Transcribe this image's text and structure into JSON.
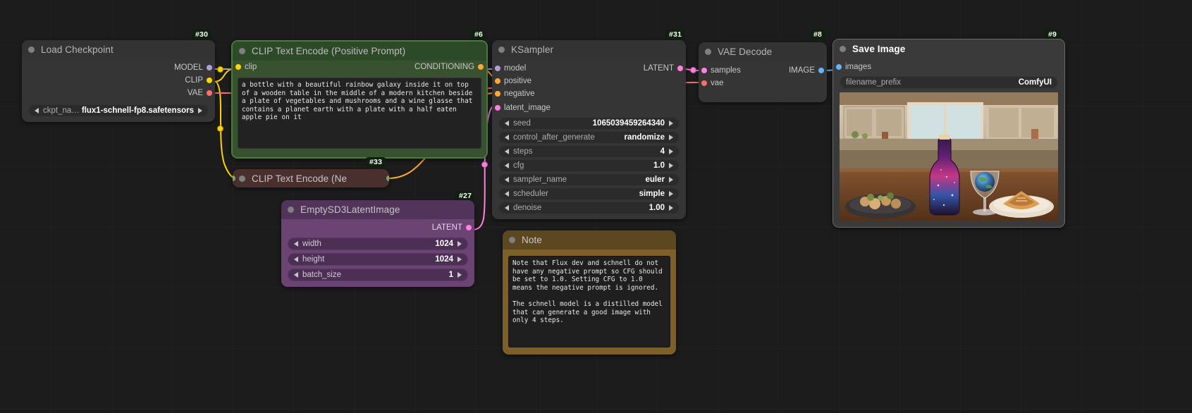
{
  "app": {
    "kind": "node-graph-editor"
  },
  "colors": {
    "canvas": "#1c1c1c",
    "node_bg": "#353535",
    "accent_positive": "#38512f",
    "accent_negative": "#4a2f2f",
    "accent_latent": "#6b4473",
    "accent_note": "#7d6029",
    "link_model": "#b39ddb",
    "link_clip": "#ffd500",
    "link_vae": "#ff6e6e",
    "link_conditioning": "#ffa931",
    "link_latent": "#ff80e0",
    "link_image": "#64b5f6"
  },
  "nodes": {
    "load_checkpoint": {
      "id_badge": "#30",
      "title": "Load Checkpoint",
      "outputs": [
        {
          "label": "MODEL",
          "type": "MODEL"
        },
        {
          "label": "CLIP",
          "type": "CLIP"
        },
        {
          "label": "VAE",
          "type": "VAE"
        }
      ],
      "widgets": [
        {
          "name": "ckpt_name",
          "value": "flux1-schnell-fp8.safetensors"
        }
      ]
    },
    "clip_positive": {
      "id_badge": "#6",
      "title": "CLIP Text Encode (Positive Prompt)",
      "inputs": [
        {
          "label": "clip",
          "type": "CLIP"
        }
      ],
      "outputs": [
        {
          "label": "CONDITIONING",
          "type": "CONDITIONING"
        }
      ],
      "text": "a bottle with a beautiful rainbow galaxy inside it on top of a wooden table in the middle of a modern kitchen beside a plate of vegetables and mushrooms and a wine glasse that contains a planet earth with a plate with a half eaten apple pie on it"
    },
    "clip_negative": {
      "id_badge": "#33",
      "title": "CLIP Text Encode (Ne",
      "collapsed": true
    },
    "ksampler": {
      "id_badge": "#31",
      "title": "KSampler",
      "inputs": [
        {
          "label": "model",
          "type": "MODEL"
        },
        {
          "label": "positive",
          "type": "CONDITIONING"
        },
        {
          "label": "negative",
          "type": "CONDITIONING"
        },
        {
          "label": "latent_image",
          "type": "LATENT"
        }
      ],
      "outputs": [
        {
          "label": "LATENT",
          "type": "LATENT"
        }
      ],
      "widgets": [
        {
          "name": "seed",
          "value": "1065039459264340"
        },
        {
          "name": "control_after_generate",
          "value": "randomize"
        },
        {
          "name": "steps",
          "value": "4"
        },
        {
          "name": "cfg",
          "value": "1.0"
        },
        {
          "name": "sampler_name",
          "value": "euler"
        },
        {
          "name": "scheduler",
          "value": "simple"
        },
        {
          "name": "denoise",
          "value": "1.00"
        }
      ]
    },
    "empty_latent": {
      "id_badge": "#27",
      "title": "EmptySD3LatentImage",
      "outputs": [
        {
          "label": "LATENT",
          "type": "LATENT"
        }
      ],
      "widgets": [
        {
          "name": "width",
          "value": "1024"
        },
        {
          "name": "height",
          "value": "1024"
        },
        {
          "name": "batch_size",
          "value": "1"
        }
      ]
    },
    "vae_decode": {
      "id_badge": "#8",
      "title": "VAE Decode",
      "inputs": [
        {
          "label": "samples",
          "type": "LATENT"
        },
        {
          "label": "vae",
          "type": "VAE"
        }
      ],
      "outputs": [
        {
          "label": "IMAGE",
          "type": "IMAGE"
        }
      ]
    },
    "save_image": {
      "id_badge": "#9",
      "title": "Save Image",
      "inputs": [
        {
          "label": "images",
          "type": "IMAGE"
        }
      ],
      "widgets": [
        {
          "name": "filename_prefix",
          "value": "ComfyUI"
        }
      ],
      "preview_alt": "generated-image-preview"
    },
    "note": {
      "title": "Note",
      "text": "Note that Flux dev and schnell do not have any negative prompt so CFG should be set to 1.0. Setting CFG to 1.0 means the negative prompt is ignored.\n\nThe schnell model is a distilled model that can generate a good image with only 4 steps."
    }
  }
}
